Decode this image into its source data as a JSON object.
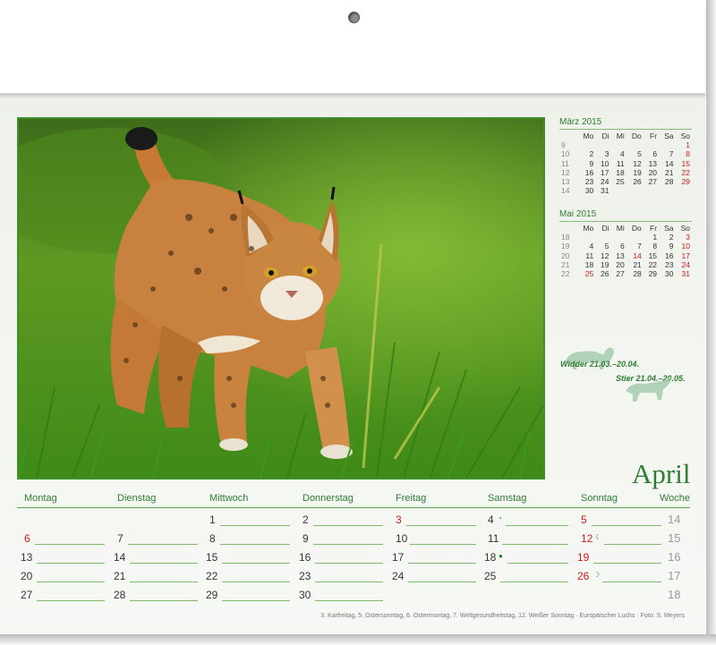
{
  "mini_calendars": [
    {
      "title": "März 2015",
      "weekdays": [
        "Mo",
        "Di",
        "Mi",
        "Do",
        "Fr",
        "Sa",
        "So"
      ],
      "weeks": [
        {
          "wk": "9",
          "days": [
            "",
            "",
            "",
            "",
            "",
            "",
            "1"
          ]
        },
        {
          "wk": "10",
          "days": [
            "2",
            "3",
            "4",
            "5",
            "6",
            "7",
            "8"
          ]
        },
        {
          "wk": "11",
          "days": [
            "9",
            "10",
            "11",
            "12",
            "13",
            "14",
            "15"
          ]
        },
        {
          "wk": "12",
          "days": [
            "16",
            "17",
            "18",
            "19",
            "20",
            "21",
            "22"
          ]
        },
        {
          "wk": "13",
          "days": [
            "23",
            "24",
            "25",
            "26",
            "27",
            "28",
            "29"
          ]
        },
        {
          "wk": "14",
          "days": [
            "30",
            "31",
            "",
            "",
            "",
            "",
            ""
          ]
        }
      ]
    },
    {
      "title": "Mai 2015",
      "weekdays": [
        "Mo",
        "Di",
        "Mi",
        "Do",
        "Fr",
        "Sa",
        "So"
      ],
      "weeks": [
        {
          "wk": "18",
          "days": [
            "",
            "",
            "",
            "",
            "1",
            "2",
            "3"
          ]
        },
        {
          "wk": "19",
          "days": [
            "4",
            "5",
            "6",
            "7",
            "8",
            "9",
            "10"
          ]
        },
        {
          "wk": "20",
          "days": [
            "11",
            "12",
            "13",
            "14",
            "15",
            "16",
            "17"
          ]
        },
        {
          "wk": "21",
          "days": [
            "18",
            "19",
            "20",
            "21",
            "22",
            "23",
            "24"
          ]
        },
        {
          "wk": "22",
          "days": [
            "25",
            "26",
            "27",
            "28",
            "29",
            "30",
            "31"
          ]
        }
      ]
    }
  ],
  "zodiac": {
    "aries": "Widder 21.03.–20.04.",
    "taurus": "Stier 21.04.–20.05."
  },
  "month": "April",
  "weekday_headers": [
    "Montag",
    "Dienstag",
    "Mittwoch",
    "Donnerstag",
    "Freitag",
    "Samstag",
    "Sonntag",
    "Woche"
  ],
  "weeks": [
    {
      "week": "14",
      "days": [
        "",
        "",
        "1",
        "2",
        "3",
        "4",
        "5"
      ],
      "moons": [
        "",
        "",
        "",
        "",
        "",
        "◔",
        ""
      ]
    },
    {
      "week": "15",
      "days": [
        "6",
        "7",
        "8",
        "9",
        "10",
        "11",
        "12"
      ],
      "moons": [
        "",
        "",
        "",
        "",
        "",
        "",
        "☾"
      ]
    },
    {
      "week": "16",
      "days": [
        "13",
        "14",
        "15",
        "16",
        "17",
        "18",
        "19"
      ],
      "moons": [
        "",
        "",
        "",
        "",
        "",
        "●",
        ""
      ]
    },
    {
      "week": "17",
      "days": [
        "20",
        "21",
        "22",
        "23",
        "24",
        "25",
        "26"
      ],
      "moons": [
        "",
        "",
        "",
        "",
        "",
        "",
        "☽"
      ]
    },
    {
      "week": "18",
      "days": [
        "27",
        "28",
        "29",
        "30",
        "",
        "",
        ""
      ],
      "moons": [
        "",
        "",
        "",
        "",
        "",
        "",
        ""
      ]
    }
  ],
  "colors": {
    "accent": "#2e7d32",
    "holiday": "#cc1b1b"
  },
  "footnote": "3. Karfreitag, 5. Ostersonntag, 6. Ostermontag, 7. Weltgesundheitstag, 12. Weißer Sonntag · Europäischer Luchs · Foto: S. Meyers"
}
